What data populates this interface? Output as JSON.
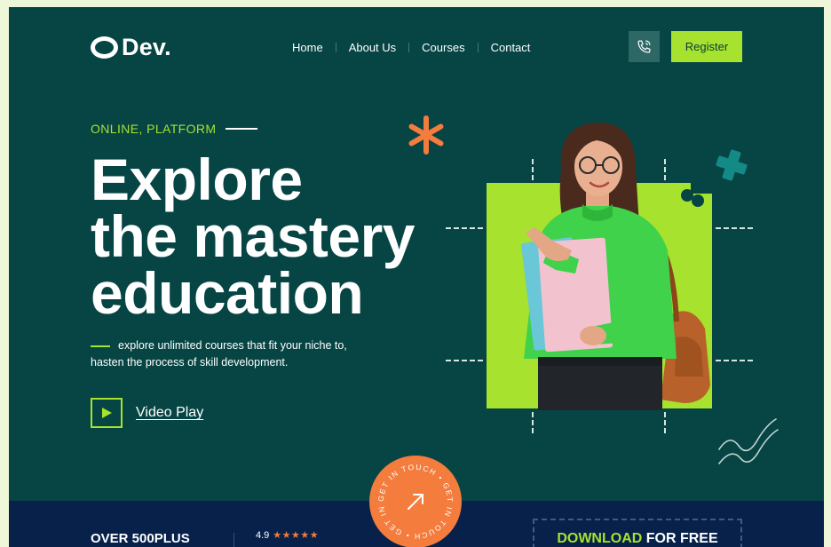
{
  "brand": {
    "name": "Dev."
  },
  "nav": {
    "items": [
      {
        "label": "Home"
      },
      {
        "label": "About Us"
      },
      {
        "label": "Courses"
      },
      {
        "label": "Contact"
      }
    ],
    "register_label": "Register",
    "phone_icon": "phone-icon"
  },
  "hero": {
    "eyebrow": "ONLINE, PLATFORM",
    "headline": [
      "Explore",
      "the mastery",
      "education"
    ],
    "description_line1": "explore unlimited courses that fit your niche to,",
    "description_line2": "hasten the  process of skill development.",
    "video_label": "Video Play"
  },
  "badge": {
    "text": "GET IN TOUCH • GET IN TOUCH • GET IN TOUCH • "
  },
  "stats": {
    "courses": "OVER 500PLUS",
    "rating": "4.9",
    "stars": "★★★★★"
  },
  "download": {
    "highlight": "DOWNLOAD",
    "rest": " FOR FREE"
  },
  "colors": {
    "background": "#064544",
    "accent": "#a6e22e",
    "orange": "#f47c3c",
    "navy": "#07214a"
  }
}
